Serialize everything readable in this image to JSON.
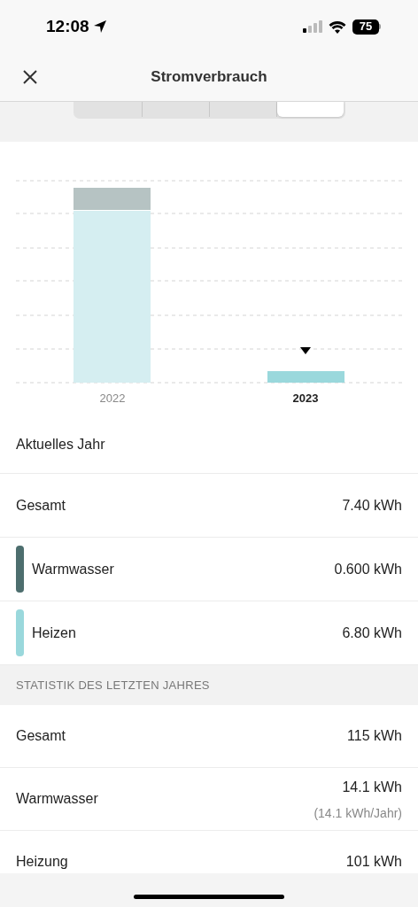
{
  "status_bar": {
    "time": "12:08",
    "battery": "75"
  },
  "header": {
    "title": "Stromverbrauch"
  },
  "segments": [
    {
      "selected": false
    },
    {
      "selected": false
    },
    {
      "selected": false
    },
    {
      "selected": true
    }
  ],
  "chart": {
    "categories": [
      {
        "label": "2022",
        "selected": false
      },
      {
        "label": "2023",
        "selected": true
      }
    ]
  },
  "current": {
    "title": "Aktuelles Jahr",
    "rows": [
      {
        "kind": "total",
        "label": "Gesamt",
        "value": "7.40 kWh"
      },
      {
        "kind": "legend",
        "label": "Warmwasser",
        "value": "0.600 kWh",
        "color": "#4d6e6e"
      },
      {
        "kind": "legend",
        "label": "Heizen",
        "value": "6.80 kWh",
        "color": "#9ad8dc"
      }
    ]
  },
  "last_year": {
    "title": "STATISTIK DES LETZTEN JAHRES",
    "rows": [
      {
        "label": "Gesamt",
        "value": "115 kWh"
      },
      {
        "label": "Warmwasser",
        "value": "14.1 kWh",
        "sub": "(14.1 kWh/Jahr)"
      },
      {
        "label": "Heizung",
        "value": "101 kWh"
      }
    ]
  }
}
